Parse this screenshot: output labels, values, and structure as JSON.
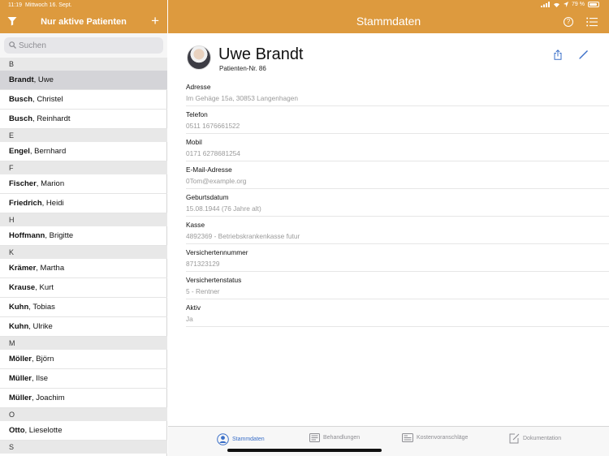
{
  "status": {
    "time": "11:19",
    "date": "Mittwoch 16. Sept.",
    "battery": "79 %"
  },
  "colors": {
    "accent": "#dd9a3e",
    "tab_active": "#3a6fc8"
  },
  "sidebar": {
    "title": "Nur aktive Patienten",
    "search_placeholder": "Suchen",
    "sections": [
      {
        "letter": "B",
        "patients": [
          {
            "last": "Brandt",
            "first": ", Uwe",
            "selected": true
          },
          {
            "last": "Busch",
            "first": ", Christel"
          },
          {
            "last": "Busch",
            "first": ", Reinhardt"
          }
        ]
      },
      {
        "letter": "E",
        "patients": [
          {
            "last": "Engel",
            "first": ", Bernhard"
          }
        ]
      },
      {
        "letter": "F",
        "patients": [
          {
            "last": "Fischer",
            "first": ", Marion"
          },
          {
            "last": "Friedrich",
            "first": ", Heidi"
          }
        ]
      },
      {
        "letter": "H",
        "patients": [
          {
            "last": "Hoffmann",
            "first": ", Brigitte"
          }
        ]
      },
      {
        "letter": "K",
        "patients": [
          {
            "last": "Krämer",
            "first": ", Martha"
          },
          {
            "last": "Krause",
            "first": ", Kurt"
          },
          {
            "last": "Kuhn",
            "first": ", Tobias"
          },
          {
            "last": "Kuhn",
            "first": ", Ulrike"
          }
        ]
      },
      {
        "letter": "M",
        "patients": [
          {
            "last": "Möller",
            "first": ", Björn"
          },
          {
            "last": "Müller",
            "first": ", Ilse"
          },
          {
            "last": "Müller",
            "first": ", Joachim"
          }
        ]
      },
      {
        "letter": "O",
        "patients": [
          {
            "last": "Otto",
            "first": ", Lieselotte"
          }
        ]
      },
      {
        "letter": "S",
        "patients": []
      }
    ]
  },
  "main": {
    "title": "Stammdaten",
    "patient_name": "Uwe Brandt",
    "patient_nr": "Patienten-Nr. 86",
    "fields": [
      {
        "label": "Adresse",
        "value": "Im Gehäge 15a, 30853 Langenhagen"
      },
      {
        "label": "Telefon",
        "value": "0511 1676661522"
      },
      {
        "label": "Mobil",
        "value": "0171 6278681254"
      },
      {
        "label": "E-Mail-Adresse",
        "value": "0Tom@example.org"
      },
      {
        "label": "Geburtsdatum",
        "value": "15.08.1944 (76 Jahre alt)"
      },
      {
        "label": "Kasse",
        "value": "4892369 - Betriebskrankenkasse futur"
      },
      {
        "label": "Versichertennummer",
        "value": "871323129"
      },
      {
        "label": "Versichertenstatus",
        "value": "5 - Rentner"
      },
      {
        "label": "Aktiv",
        "value": "Ja"
      }
    ]
  },
  "tabs": [
    {
      "label": "Stammdaten",
      "icon": "person-icon",
      "active": true
    },
    {
      "label": "Behandlungen",
      "icon": "keyboard-icon"
    },
    {
      "label": "Kostenvoranschläge",
      "icon": "calculator-icon"
    },
    {
      "label": "Dokumentation",
      "icon": "document-edit-icon"
    }
  ]
}
